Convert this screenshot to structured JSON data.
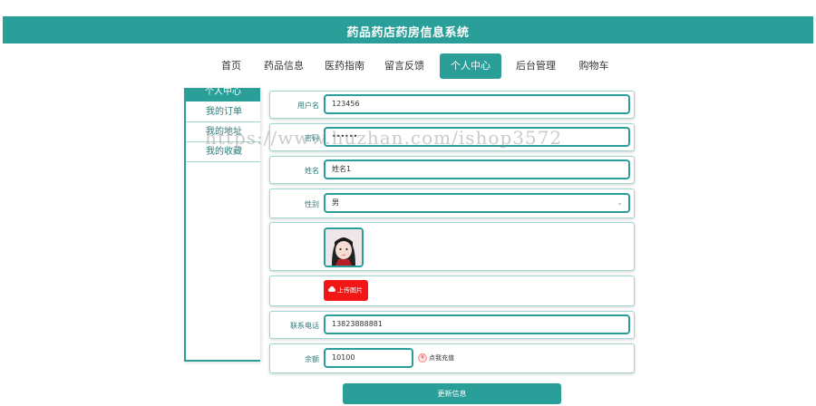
{
  "app": {
    "title": "药品药店药房信息系统"
  },
  "nav": {
    "items": [
      {
        "label": "首页",
        "active": false
      },
      {
        "label": "药品信息",
        "active": false
      },
      {
        "label": "医药指南",
        "active": false
      },
      {
        "label": "留言反馈",
        "active": false
      },
      {
        "label": "个人中心",
        "active": true
      },
      {
        "label": "后台管理",
        "active": false
      },
      {
        "label": "购物车",
        "active": false
      }
    ]
  },
  "sidebar": {
    "title": "个人中心",
    "items": [
      {
        "label": "我的订单"
      },
      {
        "label": "我的地址"
      },
      {
        "label": "我的收藏"
      }
    ]
  },
  "form": {
    "username": {
      "label": "用户名",
      "value": "123456"
    },
    "password": {
      "label": "密码",
      "value": "••••••"
    },
    "name": {
      "label": "姓名",
      "value": "姓名1"
    },
    "gender": {
      "label": "性别",
      "value": "男"
    },
    "upload_label": "上传图片",
    "phone": {
      "label": "联系电话",
      "value": "13823888881"
    },
    "balance": {
      "label": "余额",
      "value": "10100",
      "recharge_label": "点我充值",
      "recharge_icon": "¥"
    },
    "submit_label": "更新信息"
  },
  "watermark": "https://www.huzhan.com/ishop3572",
  "colors": {
    "accent": "#2a9e98",
    "upload": "#f21616",
    "text": "#333333"
  }
}
